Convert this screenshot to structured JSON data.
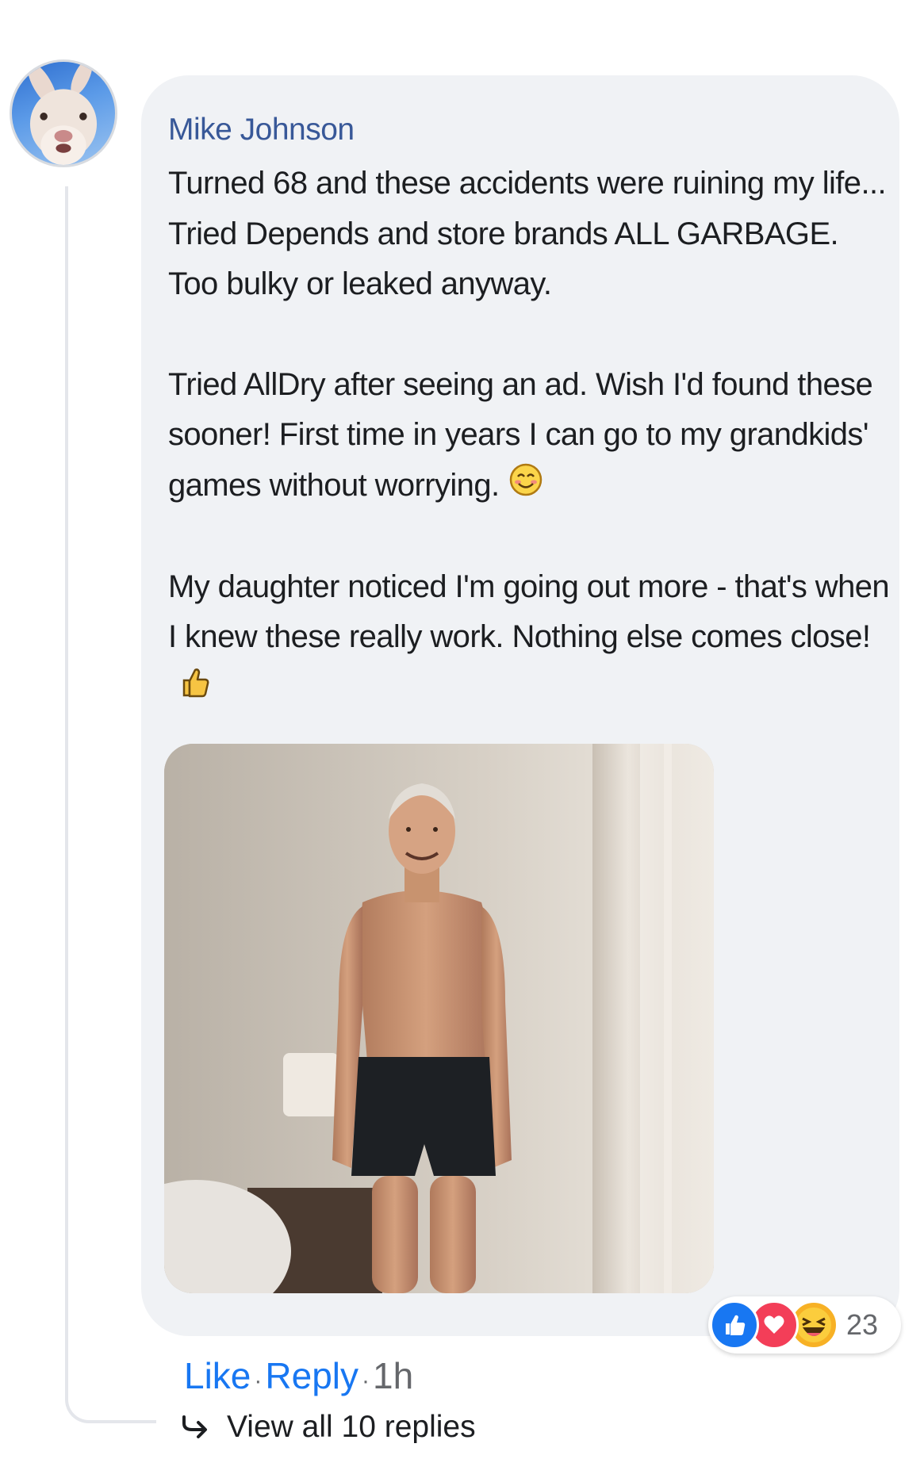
{
  "comment": {
    "author": "Mike Johnson",
    "paragraphs": [
      "Turned 68 and these accidents were ruining my life... Tried Depends and store brands ALL GARBAGE. Too bulky or leaked anyway.",
      "Tried AllDry after seeing an ad. Wish I'd found these sooner! First time in years I can go to my grandkids' games without worrying.",
      "My daughter noticed I'm going out more - that's when I knew these really work. Nothing else comes close!"
    ],
    "paragraph_emojis": [
      "",
      "smiling-face-emoji",
      "thumbs-up-emoji"
    ],
    "avatar_icon": "rabbit-avatar",
    "photo": "photo of smiling older man standing in black boxer briefs in a bedroom"
  },
  "reactions": {
    "icons": [
      "like-reaction-icon",
      "love-reaction-icon",
      "haha-reaction-icon"
    ],
    "count": "23"
  },
  "actions": {
    "like": "Like",
    "reply": "Reply",
    "separator": "·",
    "time": "1h"
  },
  "replies": {
    "label": "View all 10 replies"
  },
  "colors": {
    "bubble": "#f0f2f5",
    "author": "#385898",
    "action_link": "#1877f2",
    "muted": "#65676b"
  }
}
